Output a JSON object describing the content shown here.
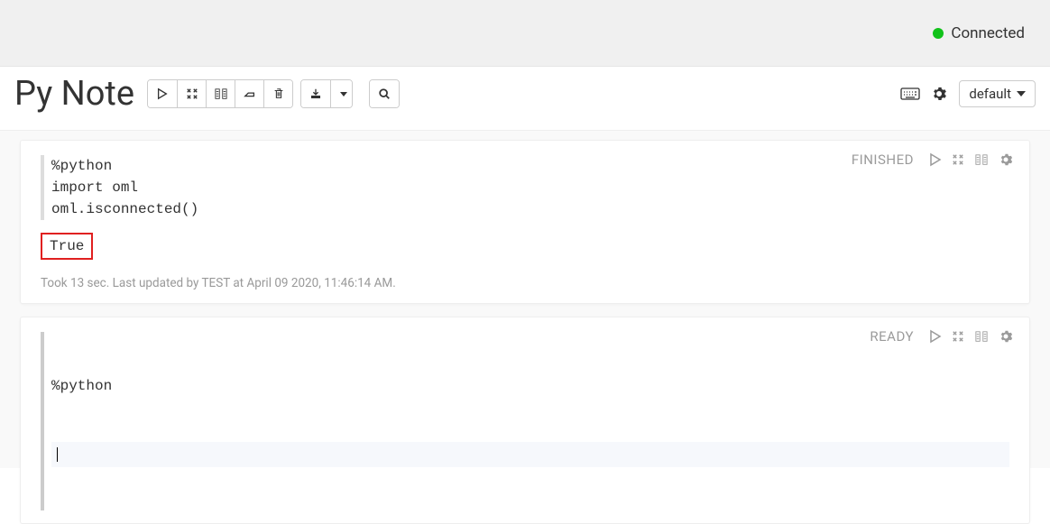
{
  "connection": {
    "status_label": "Connected",
    "color": "#11c21a"
  },
  "notebook": {
    "title": "Py Note"
  },
  "toolbar": {
    "interpreter_label": "default"
  },
  "paragraphs": [
    {
      "status": "FINISHED",
      "code": "%python\nimport oml\noml.isconnected()",
      "output": "True",
      "timing": "Took 13 sec. Last updated by TEST at April 09 2020, 11:46:14 AM."
    },
    {
      "status": "READY",
      "code": "%python",
      "output": "",
      "timing": ""
    }
  ]
}
